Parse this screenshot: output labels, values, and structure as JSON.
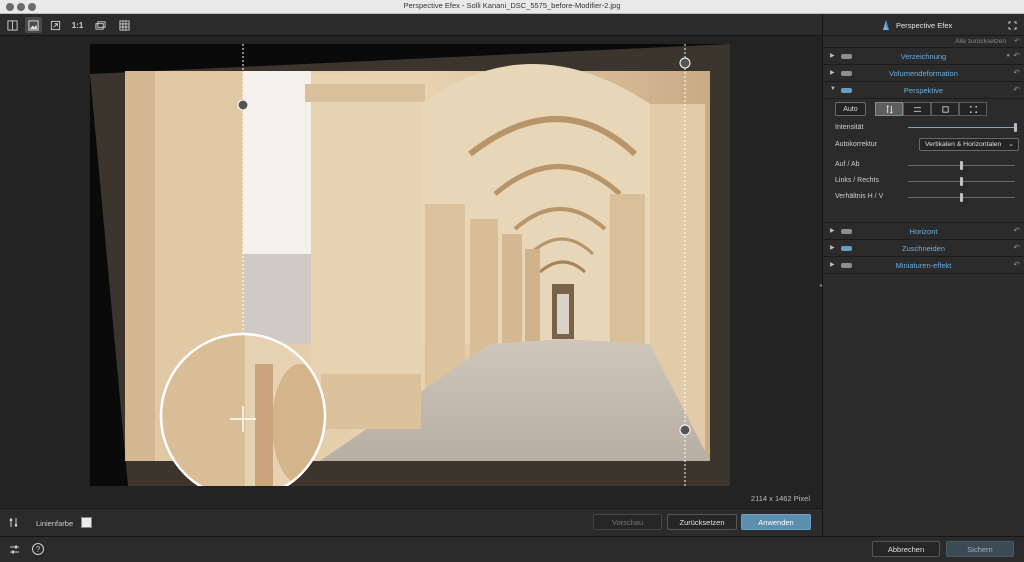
{
  "window": {
    "title": "Perspective Efex - Solli Kanani_DSC_5575_before-Modifier-2.jpg"
  },
  "toolbar": {
    "one_to_one": "1:1"
  },
  "panel": {
    "title": "Perspective Efex",
    "reset_all": "Alle zurücksetzen",
    "sections": {
      "verzeichnung": "Verzeichnung",
      "volumen": "Volumendeformation",
      "perspektive": "Perspektive",
      "horizont": "Horizont",
      "zuschneiden": "Zuschneiden",
      "miniaturen": "Miniaturen-effekt"
    },
    "perspective": {
      "auto_label": "Auto",
      "intensity_label": "Intensität",
      "intensity_value": 1.0,
      "autocorrection_label": "Autokorrektur",
      "autocorrection_value": "Vertikalen & Horizontalen",
      "up_down_label": "Auf / Ab",
      "up_down_value": 0.5,
      "left_right_label": "Links / Rechts",
      "left_right_value": 0.5,
      "ratio_label": "Verhältnis H / V",
      "ratio_value": 0.5
    }
  },
  "canvas": {
    "size_info": "2114 x 1462 Pixel"
  },
  "actionbar": {
    "line_color_label": "Linienfarbe",
    "preview": "Vorschau",
    "reset": "Zurücksetzen",
    "apply": "Anwenden"
  },
  "statusbar": {
    "help": "?",
    "cancel": "Abbrechen",
    "save": "Sichern"
  },
  "colors": {
    "accent": "#5a8fb0",
    "section_title": "#6aaee0"
  }
}
